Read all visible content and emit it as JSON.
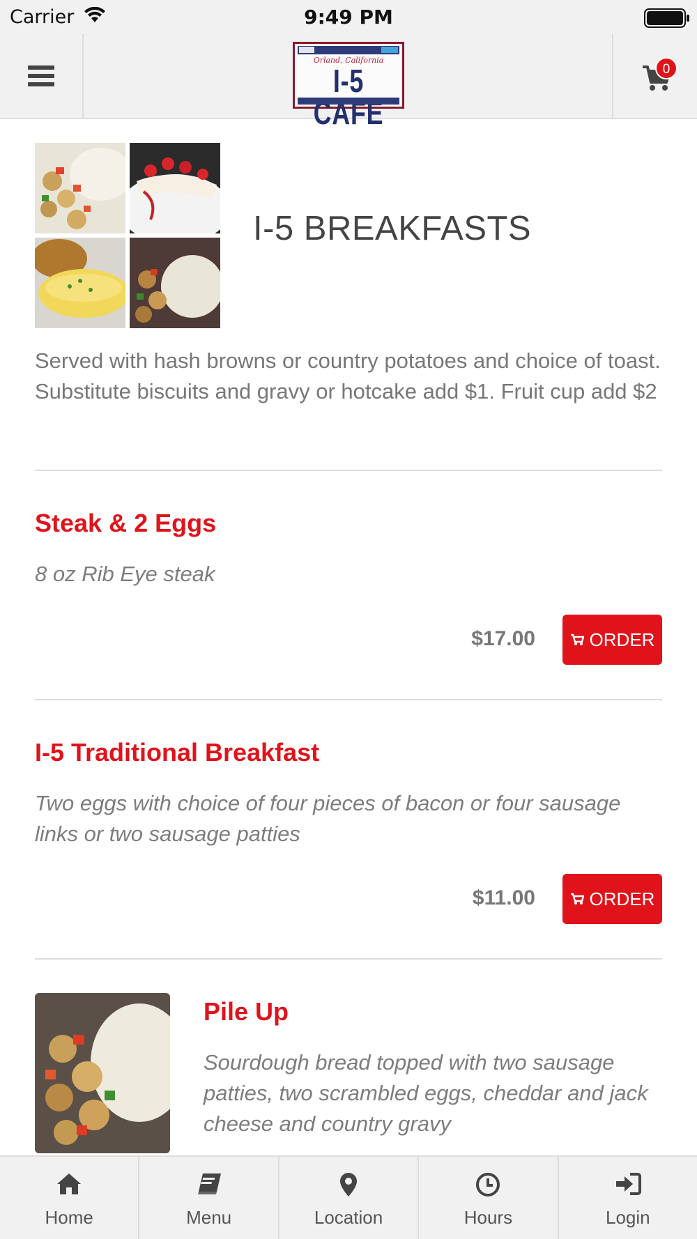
{
  "status_bar": {
    "carrier": "Carrier",
    "time": "9:49 PM"
  },
  "header": {
    "logo": {
      "script_text": "Orland, California",
      "name": "I-5 CAFE"
    },
    "cart_count": "0"
  },
  "category": {
    "title": "I-5 BREAKFASTS",
    "description": "Served with hash browns or country potatoes and choice of toast. Substitute biscuits and gravy or hotcake add $1. Fruit cup add $2"
  },
  "items": [
    {
      "name": "Steak & 2 Eggs",
      "description": "8 oz Rib Eye steak",
      "price": "$17.00",
      "order_label": "ORDER"
    },
    {
      "name": "I-5 Traditional Breakfast",
      "description": "Two eggs with choice of four pieces of bacon or four sausage links or two sausage patties",
      "price": "$11.00",
      "order_label": "ORDER"
    },
    {
      "name": "Pile Up",
      "description": "Sourdough bread topped with two sausage patties, two scrambled eggs, cheddar and jack cheese and country gravy"
    }
  ],
  "tab_bar": [
    {
      "label": "Home",
      "icon": "home-icon"
    },
    {
      "label": "Menu",
      "icon": "book-icon"
    },
    {
      "label": "Location",
      "icon": "map-pin-icon"
    },
    {
      "label": "Hours",
      "icon": "clock-icon"
    },
    {
      "label": "Login",
      "icon": "sign-in-icon"
    }
  ],
  "colors": {
    "accent": "#e0131b",
    "header_bg": "#f1f1f1",
    "price_gray": "#777777"
  }
}
